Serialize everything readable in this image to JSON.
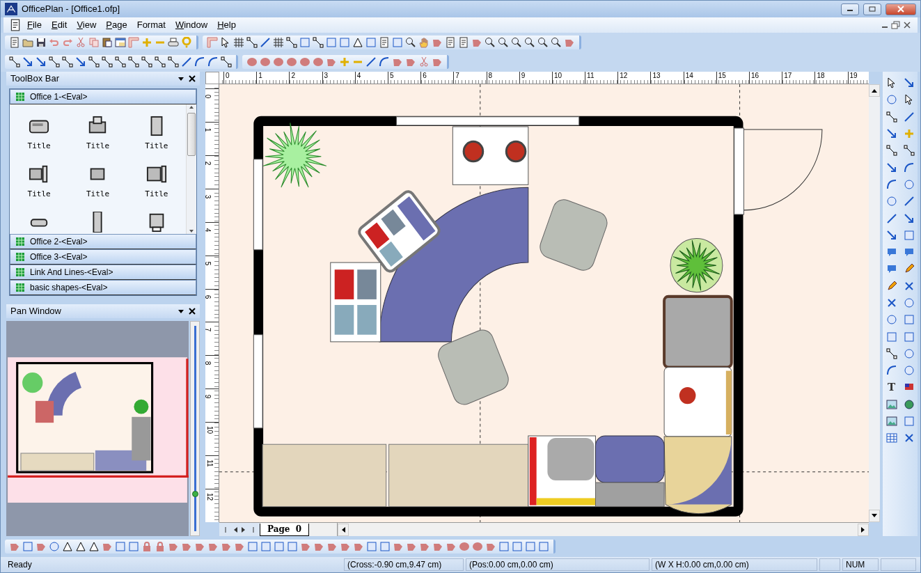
{
  "window": {
    "title": "OfficePlan - [Office1.ofp]"
  },
  "menu": [
    {
      "label": "File",
      "mnemonic": true
    },
    {
      "label": "Edit",
      "mnemonic": true
    },
    {
      "label": "View",
      "mnemonic": true
    },
    {
      "label": "Page",
      "mnemonic": true
    },
    {
      "label": "Format",
      "mnemonic": false
    },
    {
      "label": "Window",
      "mnemonic": true
    },
    {
      "label": "Help",
      "mnemonic": true
    }
  ],
  "toolbox": {
    "title": "ToolBox Bar",
    "groups": [
      {
        "label": "Office 1-<Eval>",
        "expanded": true,
        "items": [
          "Title",
          "Title",
          "Title",
          "Title",
          "Title",
          "Title"
        ]
      },
      {
        "label": "Office 2-<Eval>",
        "expanded": false
      },
      {
        "label": "Office 3-<Eval>",
        "expanded": false
      },
      {
        "label": "Link And Lines-<Eval>",
        "expanded": false
      },
      {
        "label": "basic shapes-<Eval>",
        "expanded": false
      }
    ]
  },
  "pan_window": {
    "title": "Pan Window",
    "zoom": {
      "level": 0.19
    }
  },
  "rulers": {
    "horizontal": [
      "0",
      "1",
      "2",
      "3",
      "4",
      "5",
      "6",
      "7",
      "8",
      "9",
      "10",
      "11",
      "12",
      "13",
      "14",
      "15",
      "16",
      "17",
      "18",
      "19"
    ],
    "vertical": [
      "0",
      "1",
      "2",
      "3",
      "4",
      "5",
      "6",
      "7",
      "8",
      "9",
      "10",
      "11",
      "12"
    ]
  },
  "tool_palette": {
    "text_tool": "T"
  },
  "page_tabs": [
    {
      "label": "Page  0",
      "selected": true
    }
  ],
  "status_bar": [
    "Ready",
    "(Cross:-0.90 cm,9.47 cm)",
    "(Pos:0.00 cm,0.00 cm)",
    "(W X H:0.00 cm,0.00 cm)",
    "NUM"
  ]
}
